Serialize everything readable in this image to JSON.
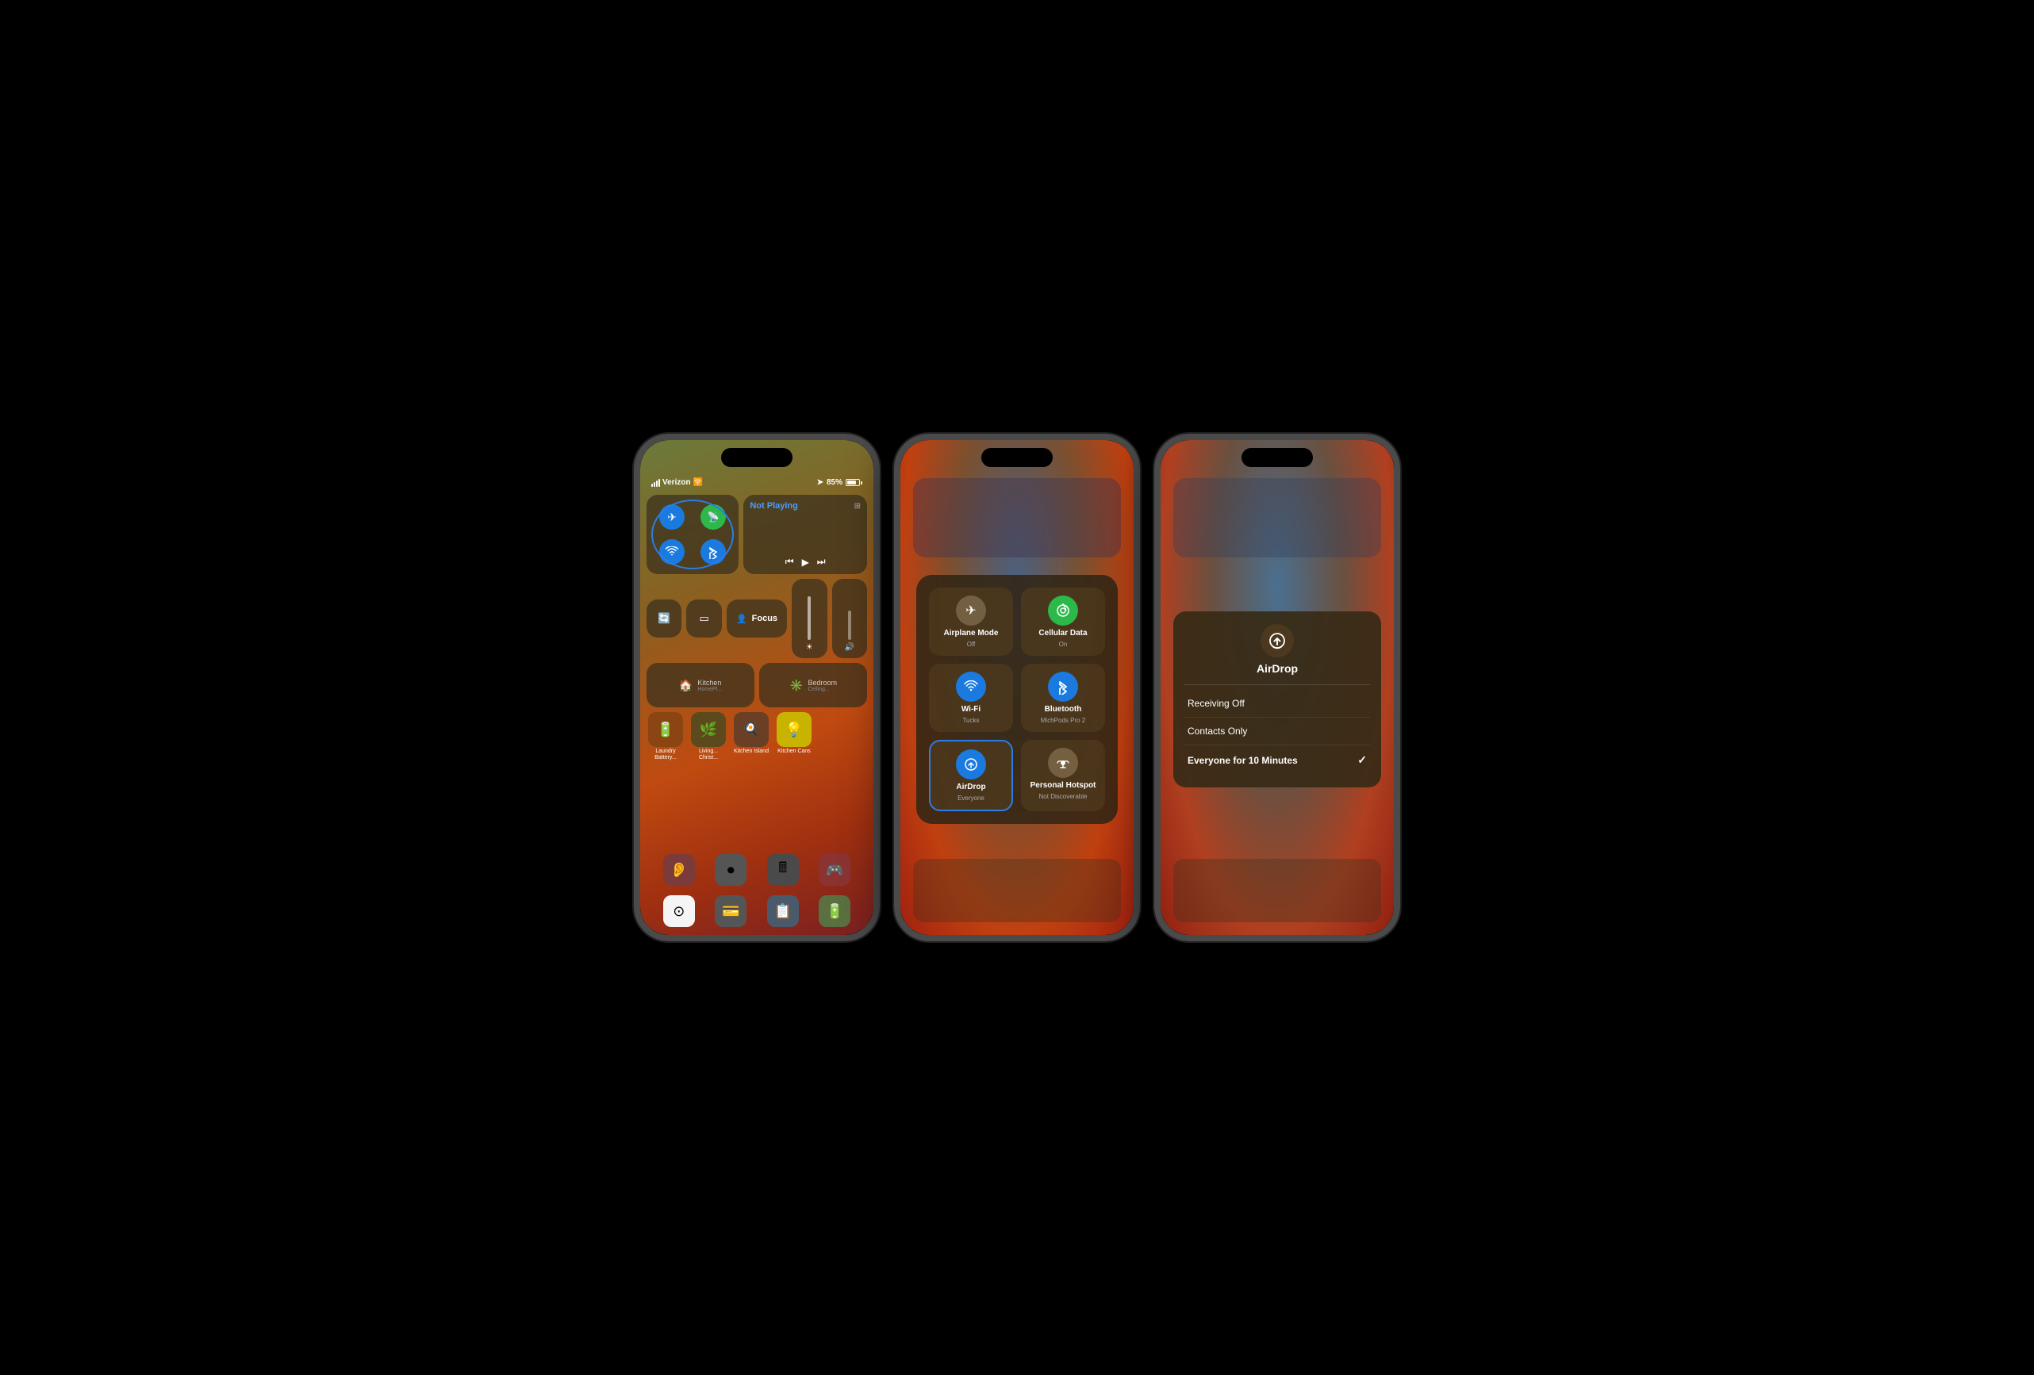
{
  "phones": [
    {
      "id": "phone1",
      "status": {
        "carrier": "Verizon",
        "wifi": true,
        "location": true,
        "battery": "85%"
      },
      "connectivity": {
        "airplane": "✈",
        "cellular": "📶",
        "wifi": "wifi",
        "bluetooth": "bluetooth"
      },
      "nowPlaying": {
        "title": "Not Playing",
        "prev": "⏮",
        "play": "▶",
        "next": "⏭"
      },
      "accessories": [
        {
          "name": "Kitchen HomePl...",
          "icon": "🏠"
        },
        {
          "name": "Bedroom Ceiling...",
          "icon": "✳️"
        }
      ],
      "apps": [
        {
          "label": "Laundry Battery...",
          "icon": "🔋",
          "color": "#8B4513"
        },
        {
          "label": "Living... Christ...",
          "icon": "🌿",
          "color": "#5C4A1E"
        },
        {
          "label": "Kitchen Island",
          "icon": "🍳",
          "color": "#6B3E26"
        },
        {
          "label": "Kitchen Cans",
          "icon": "💡",
          "color": "#F5E642"
        }
      ],
      "dock": [
        {
          "icon": "👂",
          "color": "#7B3B3B"
        },
        {
          "icon": "⏺",
          "color": "#5A5A5A"
        },
        {
          "icon": "🖩",
          "color": "#4A4A4A"
        },
        {
          "icon": "🎮",
          "color": "#8B3333"
        }
      ]
    }
  ],
  "phone2": {
    "cells": [
      {
        "name": "Airplane Mode",
        "sub": "Off",
        "icon": "✈",
        "color": "gray"
      },
      {
        "name": "Cellular Data",
        "sub": "On",
        "icon": "📡",
        "color": "green"
      },
      {
        "name": "Wi-Fi",
        "sub": "Tucks",
        "icon": "wifi",
        "color": "blue"
      },
      {
        "name": "Bluetooth",
        "sub": "MichPods Pro 2",
        "icon": "bluetooth",
        "color": "blue"
      },
      {
        "name": "AirDrop",
        "sub": "Everyone",
        "icon": "airdrop",
        "color": "blue",
        "selected": true
      },
      {
        "name": "Personal Hotspot",
        "sub": "Not Discoverable",
        "icon": "hotspot",
        "color": "gray"
      }
    ]
  },
  "phone3": {
    "airdrop": {
      "title": "AirDrop",
      "icon": "airdrop",
      "options": [
        {
          "label": "Receiving Off",
          "selected": false
        },
        {
          "label": "Contacts Only",
          "selected": false
        },
        {
          "label": "Everyone for 10 Minutes",
          "selected": true
        }
      ]
    }
  }
}
